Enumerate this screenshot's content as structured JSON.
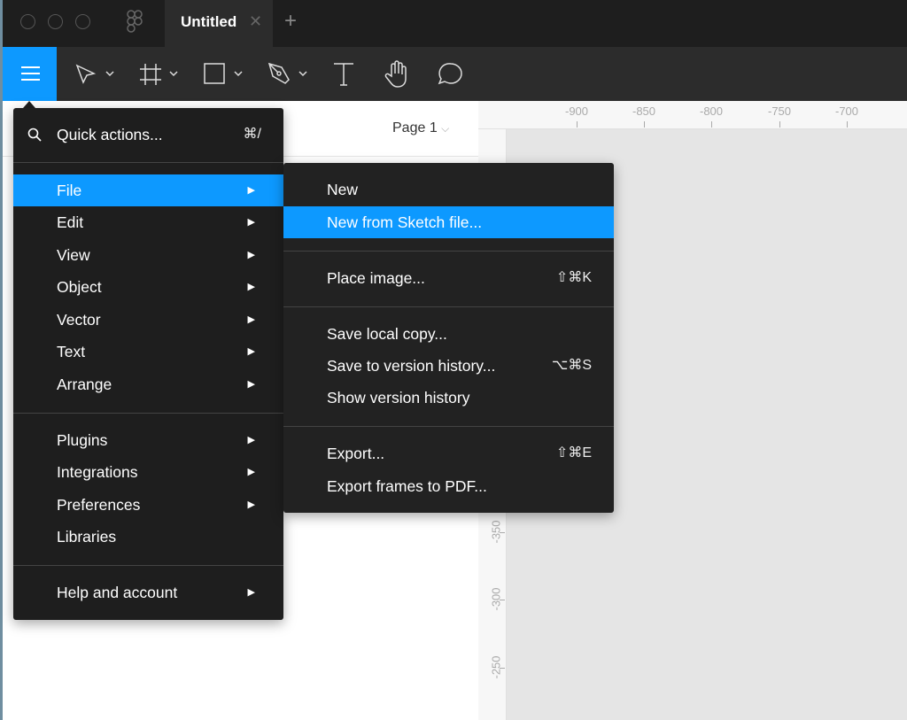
{
  "titlebar": {
    "tab_title": "Untitled",
    "close": "✕",
    "add": "+"
  },
  "toolbar": {
    "tools": [
      "menu-icon",
      "move-icon",
      "frame-icon",
      "rectangle-icon",
      "pen-icon",
      "text-icon",
      "hand-icon",
      "comment-icon"
    ]
  },
  "left_panel": {
    "page_selector": "Page 1"
  },
  "rulers": {
    "top": [
      "-900",
      "-850",
      "-800",
      "-750",
      "-700"
    ],
    "left": [
      "-350",
      "-300",
      "-250"
    ]
  },
  "main_menu": {
    "quick_actions": {
      "label": "Quick actions...",
      "shortcut": "⌘/"
    },
    "items": [
      {
        "label": "File",
        "arrow": "▶"
      },
      {
        "label": "Edit",
        "arrow": "▶"
      },
      {
        "label": "View",
        "arrow": "▶"
      },
      {
        "label": "Object",
        "arrow": "▶"
      },
      {
        "label": "Vector",
        "arrow": "▶"
      },
      {
        "label": "Text",
        "arrow": "▶"
      },
      {
        "label": "Arrange",
        "arrow": "▶"
      },
      {
        "label": "Plugins",
        "arrow": "▶"
      },
      {
        "label": "Integrations",
        "arrow": "▶"
      },
      {
        "label": "Preferences",
        "arrow": "▶"
      },
      {
        "label": "Libraries"
      },
      {
        "label": "Help and account",
        "arrow": "▶"
      }
    ]
  },
  "file_menu": {
    "items": [
      {
        "label": "New"
      },
      {
        "label": "New from Sketch file..."
      },
      {
        "label": "Place image...",
        "shortcut": "⇧⌘K"
      },
      {
        "label": "Save local copy..."
      },
      {
        "label": "Save to version history...",
        "shortcut": "⌥⌘S"
      },
      {
        "label": "Show version history"
      },
      {
        "label": "Export...",
        "shortcut": "⇧⌘E"
      },
      {
        "label": "Export frames to PDF..."
      }
    ]
  },
  "colors": {
    "accent": "#0d99ff",
    "menu_bg": "#1e1e1e"
  }
}
